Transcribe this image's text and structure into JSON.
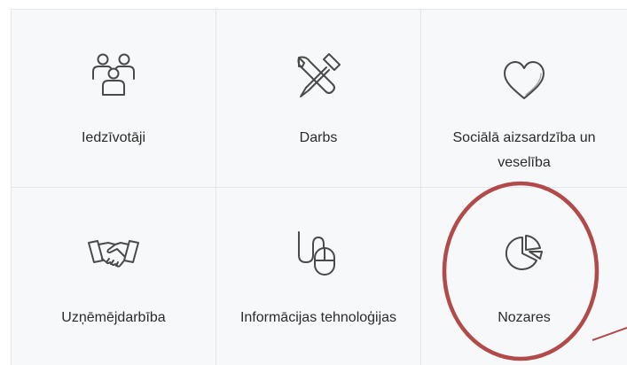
{
  "tiles": [
    {
      "label": "Iedzīvotāji",
      "icon": "people-icon"
    },
    {
      "label": "Darbs",
      "icon": "tools-icon"
    },
    {
      "label": "Sociālā aizsardzība un veselība",
      "icon": "heart-icon"
    },
    {
      "label": "Uzņēmējdarbība",
      "icon": "handshake-icon"
    },
    {
      "label": "Informācijas tehnoloģijas",
      "icon": "mouse-icon"
    },
    {
      "label": "Nozares",
      "icon": "pie-chart-icon"
    }
  ],
  "colors": {
    "tile_background": "#f6f8f9",
    "divider": "#e3e7ea",
    "icon_stroke": "#4a4a4a",
    "highlight_circle": "#b34a4a"
  }
}
